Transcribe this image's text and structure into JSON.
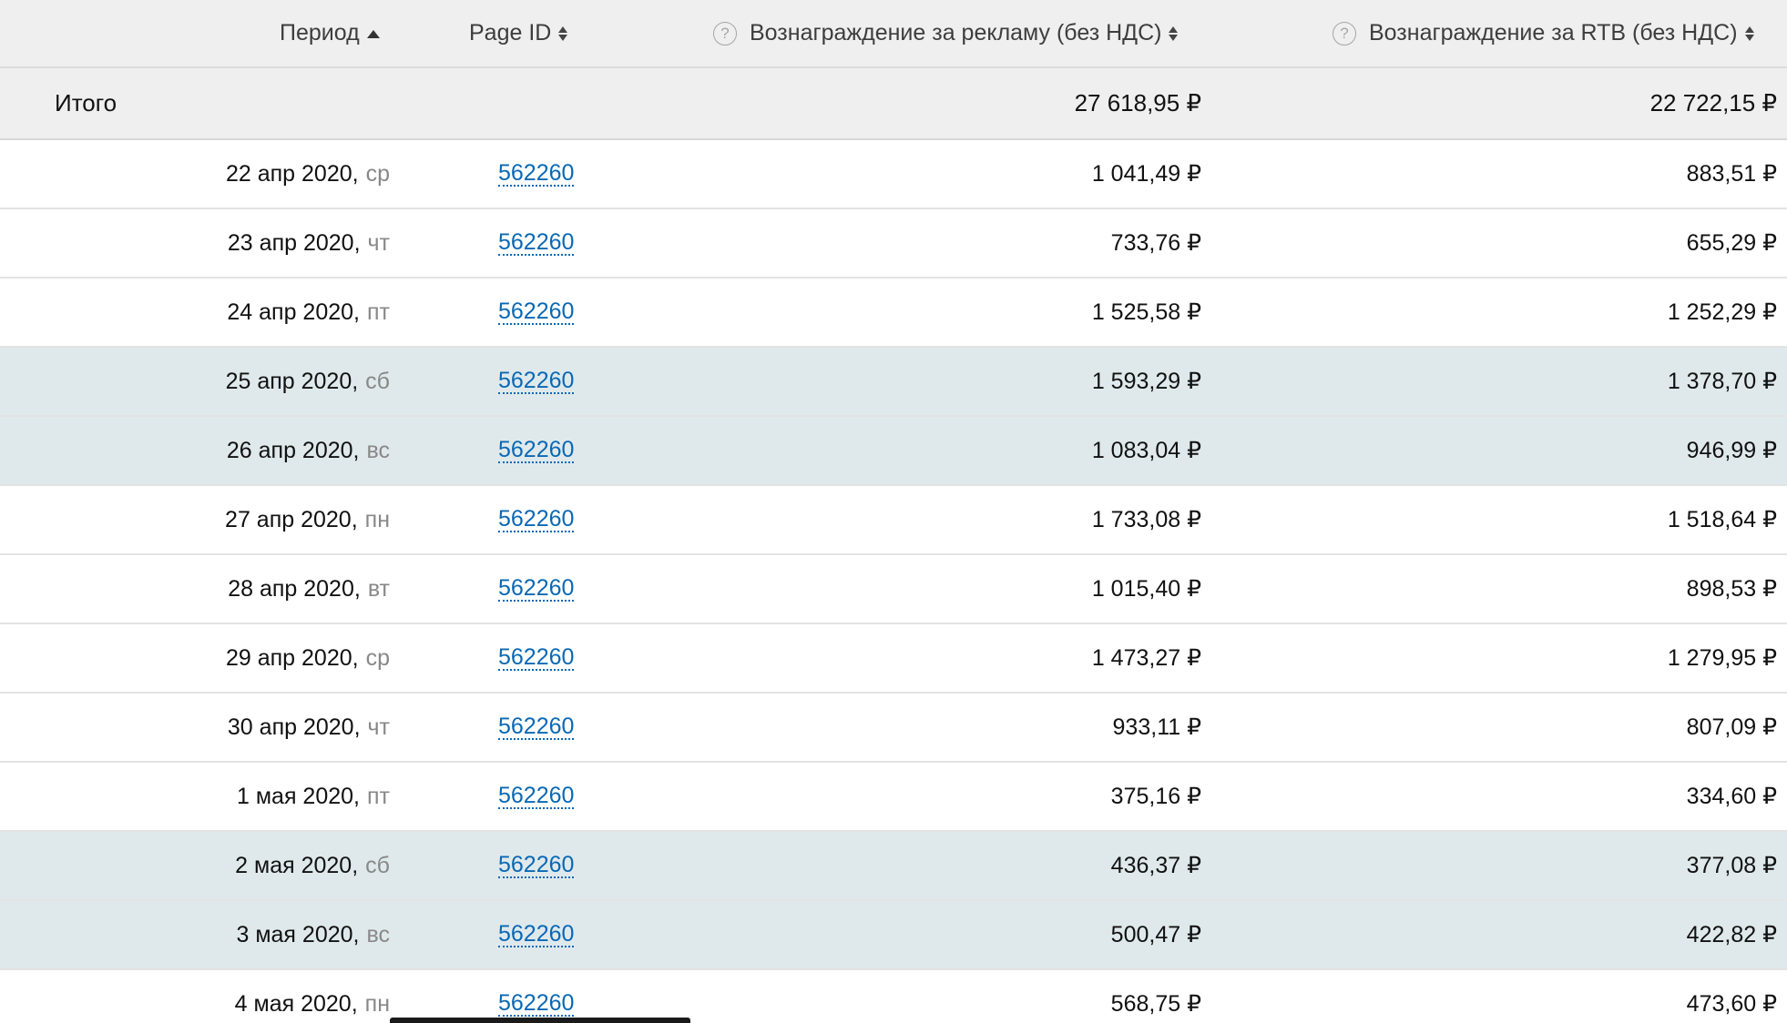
{
  "header": {
    "period": "Период",
    "page_id": "Page ID",
    "ad_reward": "Вознаграждение за рекламу (без НДС)",
    "rtb_reward": "Вознаграждение за RTB (без НДС)",
    "help_icon": "help-circle-icon",
    "help_glyph": "?"
  },
  "total": {
    "label": "Итого",
    "ad_reward": "27 618,95 ₽",
    "rtb_reward": "22 722,15 ₽"
  },
  "rows": [
    {
      "date": "22 апр 2020,",
      "weekday": "ср",
      "page_id": "562260",
      "ad": "1 041,49 ₽",
      "rtb": "883,51 ₽",
      "weekend": false
    },
    {
      "date": "23 апр 2020,",
      "weekday": "чт",
      "page_id": "562260",
      "ad": "733,76 ₽",
      "rtb": "655,29 ₽",
      "weekend": false
    },
    {
      "date": "24 апр 2020,",
      "weekday": "пт",
      "page_id": "562260",
      "ad": "1 525,58 ₽",
      "rtb": "1 252,29 ₽",
      "weekend": false
    },
    {
      "date": "25 апр 2020,",
      "weekday": "сб",
      "page_id": "562260",
      "ad": "1 593,29 ₽",
      "rtb": "1 378,70 ₽",
      "weekend": true
    },
    {
      "date": "26 апр 2020,",
      "weekday": "вс",
      "page_id": "562260",
      "ad": "1 083,04 ₽",
      "rtb": "946,99 ₽",
      "weekend": true
    },
    {
      "date": "27 апр 2020,",
      "weekday": "пн",
      "page_id": "562260",
      "ad": "1 733,08 ₽",
      "rtb": "1 518,64 ₽",
      "weekend": false
    },
    {
      "date": "28 апр 2020,",
      "weekday": "вт",
      "page_id": "562260",
      "ad": "1 015,40 ₽",
      "rtb": "898,53 ₽",
      "weekend": false
    },
    {
      "date": "29 апр 2020,",
      "weekday": "ср",
      "page_id": "562260",
      "ad": "1 473,27 ₽",
      "rtb": "1 279,95 ₽",
      "weekend": false
    },
    {
      "date": "30 апр 2020,",
      "weekday": "чт",
      "page_id": "562260",
      "ad": "933,11 ₽",
      "rtb": "807,09 ₽",
      "weekend": false
    },
    {
      "date": "1 мая 2020,",
      "weekday": "пт",
      "page_id": "562260",
      "ad": "375,16 ₽",
      "rtb": "334,60 ₽",
      "weekend": false
    },
    {
      "date": "2 мая 2020,",
      "weekday": "сб",
      "page_id": "562260",
      "ad": "436,37 ₽",
      "rtb": "377,08 ₽",
      "weekend": true
    },
    {
      "date": "3 мая 2020,",
      "weekday": "вс",
      "page_id": "562260",
      "ad": "500,47 ₽",
      "rtb": "422,82 ₽",
      "weekend": true
    },
    {
      "date": "4 мая 2020,",
      "weekday": "пн",
      "page_id": "562260",
      "ad": "568,75 ₽",
      "rtb": "473,60 ₽",
      "weekend": false
    }
  ]
}
